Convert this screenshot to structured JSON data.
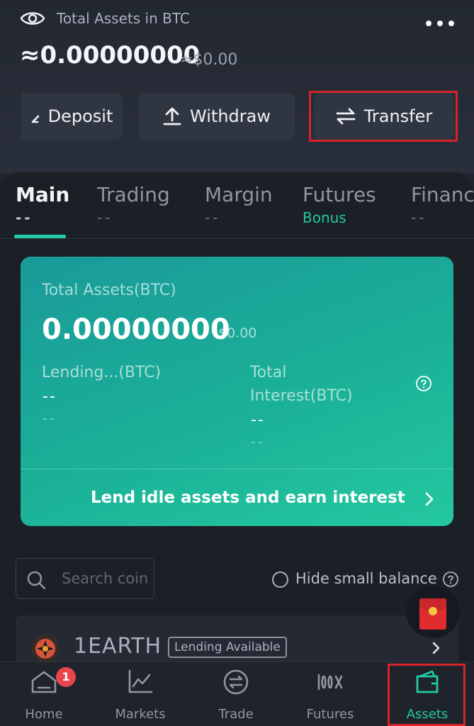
{
  "header": {
    "title": "Total Assets in BTC",
    "balance": "≈0.00000000",
    "balance_usd": "≈$0.00"
  },
  "actions": {
    "deposit": "Deposit",
    "withdraw": "Withdraw",
    "transfer": "Transfer"
  },
  "tabs": [
    {
      "label": "Main",
      "sub": "--",
      "active": true
    },
    {
      "label": "Trading",
      "sub": "--"
    },
    {
      "label": "Margin",
      "sub": "--"
    },
    {
      "label": "Futures",
      "sub": "Bonus"
    },
    {
      "label": "Financ",
      "sub": "--"
    }
  ],
  "card": {
    "total_label": "Total Assets(BTC)",
    "total_value": "0.00000000",
    "total_usd": "$0.00",
    "lending_label": "Lending...(BTC)",
    "lending_value": "--",
    "lending_sub": "--",
    "interest_label_1": "Total",
    "interest_label_2": "Interest(BTC)",
    "interest_value": "--",
    "interest_sub": "--",
    "cta": "Lend idle assets and earn interest"
  },
  "search": {
    "placeholder": "Search coin"
  },
  "hide_small": "Hide small balances",
  "coin": {
    "name": "1EARTH",
    "badge": "Lending Available"
  },
  "nav": {
    "home": "Home",
    "markets": "Markets",
    "trade": "Trade",
    "futures": "Futures",
    "assets": "Assets",
    "home_badge": "1"
  },
  "colors": {
    "accent": "#23c9a3",
    "highlight": "#d5232b",
    "background": "#1f232b",
    "card_start": "#1a9a9a",
    "card_end": "#23c8a0"
  }
}
